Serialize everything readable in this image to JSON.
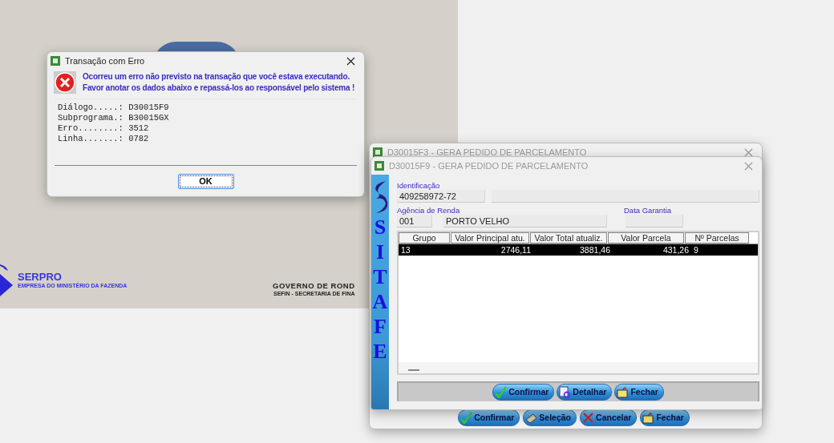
{
  "desktop": {
    "footer_left": {
      "title": "SERPRO",
      "subtitle": "EMPRESA DO MINISTÉRIO DA FAZENDA"
    },
    "footer_right": {
      "title": "GOVERNO DE ROND",
      "subtitle": "SEFIN - SECRETARIA DE FINA"
    }
  },
  "error_dialog": {
    "title": "Transação com Erro",
    "message_lines": [
      "Ocorreu um erro não previsto na transação que você estava executando.",
      "Favor anotar os dados abaixo e repassá-los ao responsável pelo sistema !"
    ],
    "details": [
      "Diálogo.....: D30015F9",
      "Subprograma.: B30015GX",
      "Erro........: 3512",
      "Linha.......: 0782"
    ],
    "button": "OK"
  },
  "back_window": {
    "title": "D30015F3 - GERA PEDIDO DE PARCELAMENTO",
    "buttons": [
      {
        "label": "Confirmar",
        "kind": "confirm"
      },
      {
        "label": "Seleção",
        "kind": "select"
      },
      {
        "label": "Cancelar",
        "kind": "cancel"
      },
      {
        "label": "Fechar",
        "kind": "close"
      }
    ]
  },
  "front_window": {
    "title": "D30015F9 - GERA PEDIDO DE PARCELAMENTO",
    "brand_letters": [
      "S",
      "I",
      "T",
      "A",
      "F",
      "E"
    ],
    "identificacao": {
      "label": "Identificação",
      "value": "409258972-72"
    },
    "agencia": {
      "label": "Agência de Renda",
      "code": "001",
      "name": "PORTO VELHO"
    },
    "data_garantia": {
      "label": "Data Garantia"
    },
    "table": {
      "columns": [
        "Grupo",
        "Valor Principal atu.",
        "Valor Total atualiz.",
        "Valor Parcela",
        "Nº Parcelas"
      ],
      "rows": [
        {
          "cells": [
            "13",
            "2746,11",
            "3881,46",
            "431,26",
            "9"
          ],
          "selected": true
        }
      ]
    },
    "buttons": [
      {
        "label": "Confirmar",
        "kind": "confirm"
      },
      {
        "label": "Detalhar",
        "kind": "detail"
      },
      {
        "label": "Fechar",
        "kind": "close"
      }
    ]
  }
}
